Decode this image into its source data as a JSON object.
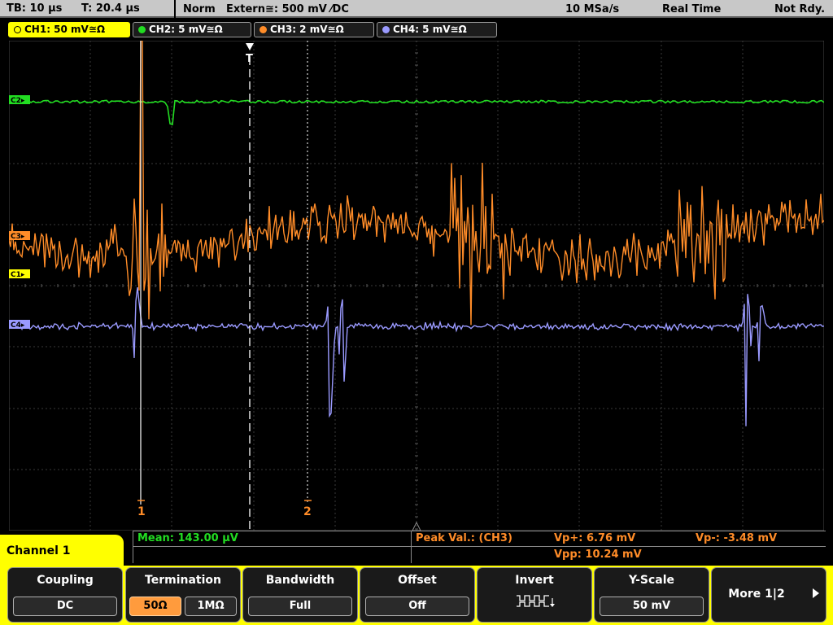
{
  "status": {
    "timebase": "TB: 10 µs",
    "trigger_pos": "T: 20.4 µs",
    "mode": "Norm",
    "trigger_source": "Extern≅: 500 mV ⁄DC",
    "sample_rate": "10 MSa/s",
    "acq_mode": "Real Time",
    "state": "Not Rdy."
  },
  "channels": [
    {
      "label": "CH1: 50 mV≅Ω",
      "color": "#ffff00"
    },
    {
      "label": "CH2: 5 mV≅Ω",
      "color": "#22dd22"
    },
    {
      "label": "CH3: 2 mV≅Ω",
      "color": "#ff8c28"
    },
    {
      "label": "CH4: 5 mV≅Ω",
      "color": "#9a9aff"
    }
  ],
  "markers": {
    "ch2": "C2▸",
    "ch3": "C3▸",
    "ch1": "C1▸",
    "ch4": "C4▸",
    "trigger": "T",
    "cursor1": "1",
    "cursor2": "2"
  },
  "measurements": {
    "mean": "Mean: 143.00 µV",
    "peak_label": "Peak Val.:  (CH3)",
    "vp_plus": "Vp+: 6.76 mV",
    "vp_minus": "Vp-: -3.48 mV",
    "vpp": "Vpp: 10.24 mV"
  },
  "menu": {
    "title": "Channel 1",
    "coupling": {
      "title": "Coupling",
      "value": "DC"
    },
    "termination": {
      "title": "Termination",
      "opt1": "50Ω",
      "opt2": "1MΩ"
    },
    "bandwidth": {
      "title": "Bandwidth",
      "value": "Full"
    },
    "offset": {
      "title": "Offset",
      "value": "Off"
    },
    "invert": {
      "title": "Invert",
      "icon": "invert-waveform-icon"
    },
    "yscale": {
      "title": "Y-Scale",
      "value": "50 mV"
    },
    "more": {
      "label": "More 1|2",
      "icon": "arrow-right-icon"
    }
  },
  "colors": {
    "ch1": "#ffff00",
    "ch2": "#22dd22",
    "ch3": "#ff8c28",
    "ch4": "#9a9aff",
    "grid": "#3c3c3c"
  }
}
